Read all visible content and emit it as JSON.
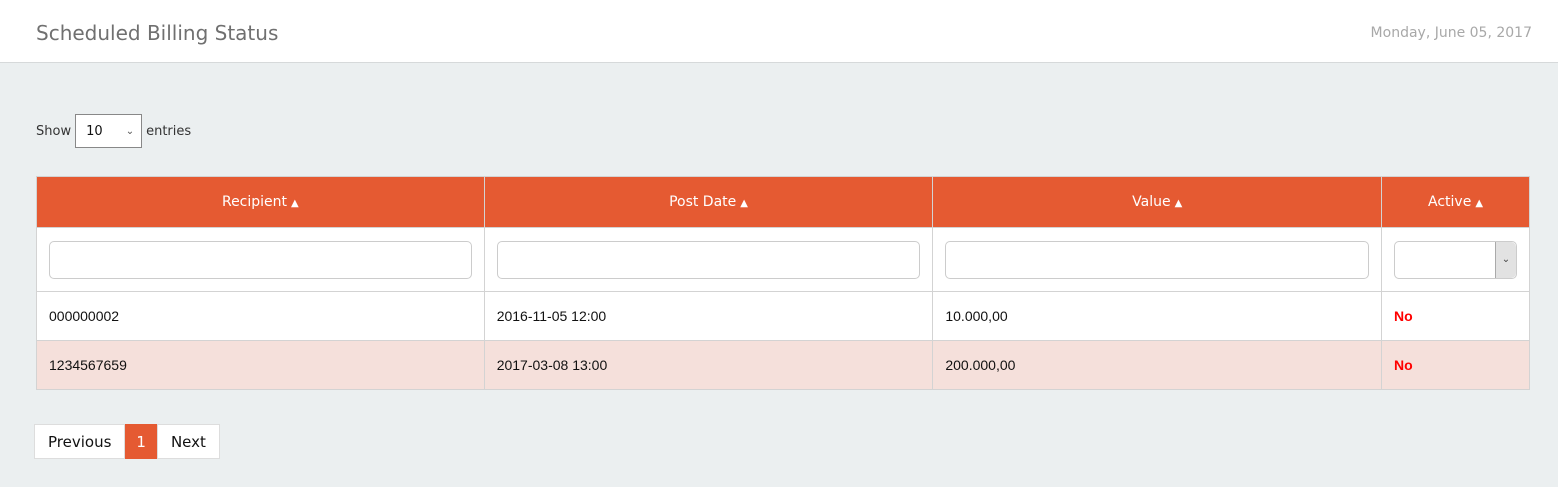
{
  "header": {
    "title": "Scheduled Billing Status",
    "date": "Monday, June 05, 2017"
  },
  "length": {
    "show": "Show",
    "value": "10",
    "entries": "entries"
  },
  "table": {
    "columns": [
      "Recipient",
      "Post Date",
      "Value",
      "Active"
    ],
    "rows": [
      {
        "recipient": "000000002",
        "post_date": "2016-11-05 12:00",
        "value": "10.000,00",
        "active": "No"
      },
      {
        "recipient": "1234567659",
        "post_date": "2017-03-08 13:00",
        "value": "200.000,00",
        "active": "No"
      }
    ]
  },
  "pagination": {
    "previous": "Previous",
    "current": "1",
    "next": "Next"
  },
  "colors": {
    "accent": "#e55a32",
    "inactive": "#ff0000",
    "row_highlight": "#f5e0db"
  }
}
